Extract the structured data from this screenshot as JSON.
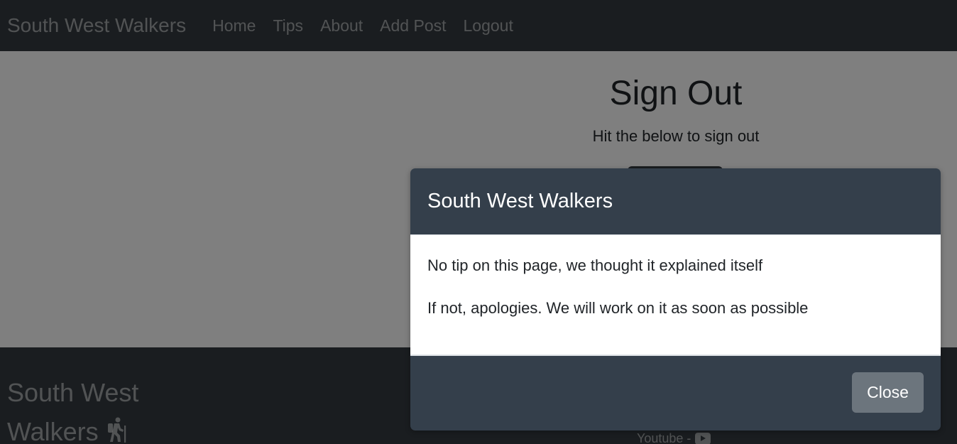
{
  "navbar": {
    "brand": "South West Walkers",
    "links": [
      {
        "label": "Home"
      },
      {
        "label": "Tips"
      },
      {
        "label": "About"
      },
      {
        "label": "Add Post"
      },
      {
        "label": "Logout"
      }
    ]
  },
  "main": {
    "title": "Sign Out",
    "subtitle": "Hit the below to sign out"
  },
  "footer": {
    "brand": "South West Walkers",
    "youtube_label": "Youtube -",
    "hiker_icon": "person-hiking-icon",
    "youtube_icon": "youtube-icon"
  },
  "modal": {
    "title": "South West Walkers",
    "body_lines": [
      "No tip on this page, we thought it explained itself",
      "If not, apologies. We will work on it as soon as possible"
    ],
    "close_label": "Close"
  },
  "colors": {
    "navbar_bg": "#343a40",
    "modal_header_bg": "#343f4b",
    "close_button_bg": "#6c757d",
    "backdrop": "rgba(0,0,0,0.5)"
  }
}
